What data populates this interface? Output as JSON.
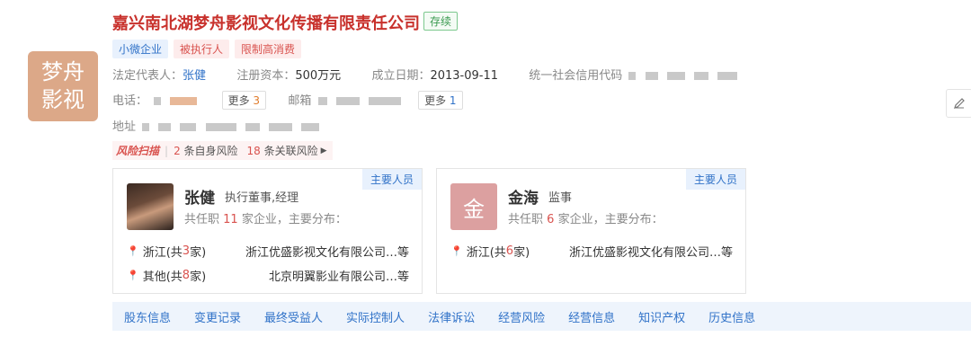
{
  "company": {
    "logo_line1": "梦舟",
    "logo_line2": "影视",
    "name": "嘉兴南北湖梦舟影视文化传播有限责任公司",
    "status": "存续",
    "tags": [
      "小微企业",
      "被执行人",
      "限制高消费"
    ]
  },
  "info": {
    "legal_rep_label": "法定代表人：",
    "legal_rep": "张健",
    "capital_label": "注册资本：",
    "capital": "500万元",
    "date_label": "成立日期：",
    "date": "2013-09-11",
    "credit_label": "统一社会信用代码",
    "phone_label": "电话：",
    "phone_more_label": "更多",
    "phone_more_count": "3",
    "email_label": "邮箱",
    "email_more_label": "更多",
    "email_more_count": "1",
    "address_label": "地址"
  },
  "risk": {
    "logo": "风险扫描",
    "self_count": "2",
    "self_label": "条自身风险",
    "related_count": "18",
    "related_label": "条关联风险"
  },
  "people": [
    {
      "badge": "主要人员",
      "name": "张健",
      "role": "执行董事,经理",
      "stat_prefix": "共任职",
      "stat_count": "11",
      "stat_suffix": "家企业，主要分布：",
      "locations": [
        {
          "region": "浙江(共",
          "count": "3",
          "unit": "家)",
          "company": "浙江优盛影视文化有限公司…等"
        },
        {
          "region": "其他(共",
          "count": "8",
          "unit": "家)",
          "company": "北京明翼影业有限公司…等"
        }
      ]
    },
    {
      "badge": "主要人员",
      "avatar_char": "金",
      "name": "金海",
      "role": "监事",
      "stat_prefix": "共任职",
      "stat_count": "6",
      "stat_suffix": "家企业，主要分布：",
      "locations": [
        {
          "region": "浙江(共",
          "count": "6",
          "unit": "家)",
          "company": "浙江优盛影视文化有限公司…等"
        }
      ]
    }
  ],
  "tabs": [
    "股东信息",
    "变更记录",
    "最终受益人",
    "实际控制人",
    "法律诉讼",
    "经营风险",
    "经营信息",
    "知识产权",
    "历史信息"
  ],
  "icons": {
    "edit": "pencil-icon",
    "pin": "location-pin-icon"
  },
  "colors": {
    "title_red": "#c8312c",
    "link_blue": "#3072c8",
    "logo_bg": "#dca888"
  }
}
